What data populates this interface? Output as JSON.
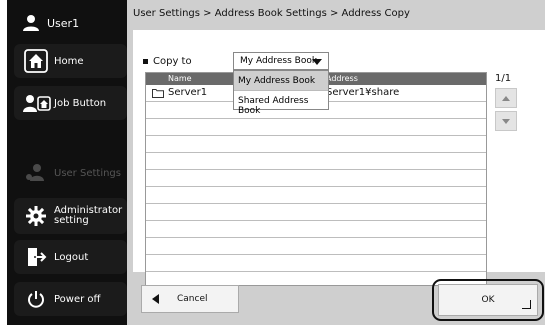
{
  "sidebar": {
    "user_label": "User1",
    "home_label": "Home",
    "job_button_label": "Job Button",
    "user_settings_label": "User Settings",
    "admin_label_line1": "Administrator",
    "admin_label_line2": "setting",
    "logout_label": "Logout",
    "power_label": "Power off"
  },
  "breadcrumb": "User Settings > Address Book Settings > Address Copy",
  "copy_to": {
    "label": "Copy to",
    "selected": "My Address Book",
    "options": [
      "My Address Book",
      "Shared Address Book"
    ]
  },
  "table": {
    "columns": [
      "Name",
      "Address"
    ],
    "rows": [
      {
        "name": "Server1",
        "address": "Server1¥share"
      }
    ]
  },
  "pagination": "1/1",
  "buttons": {
    "cancel": "Cancel",
    "ok": "OK"
  }
}
